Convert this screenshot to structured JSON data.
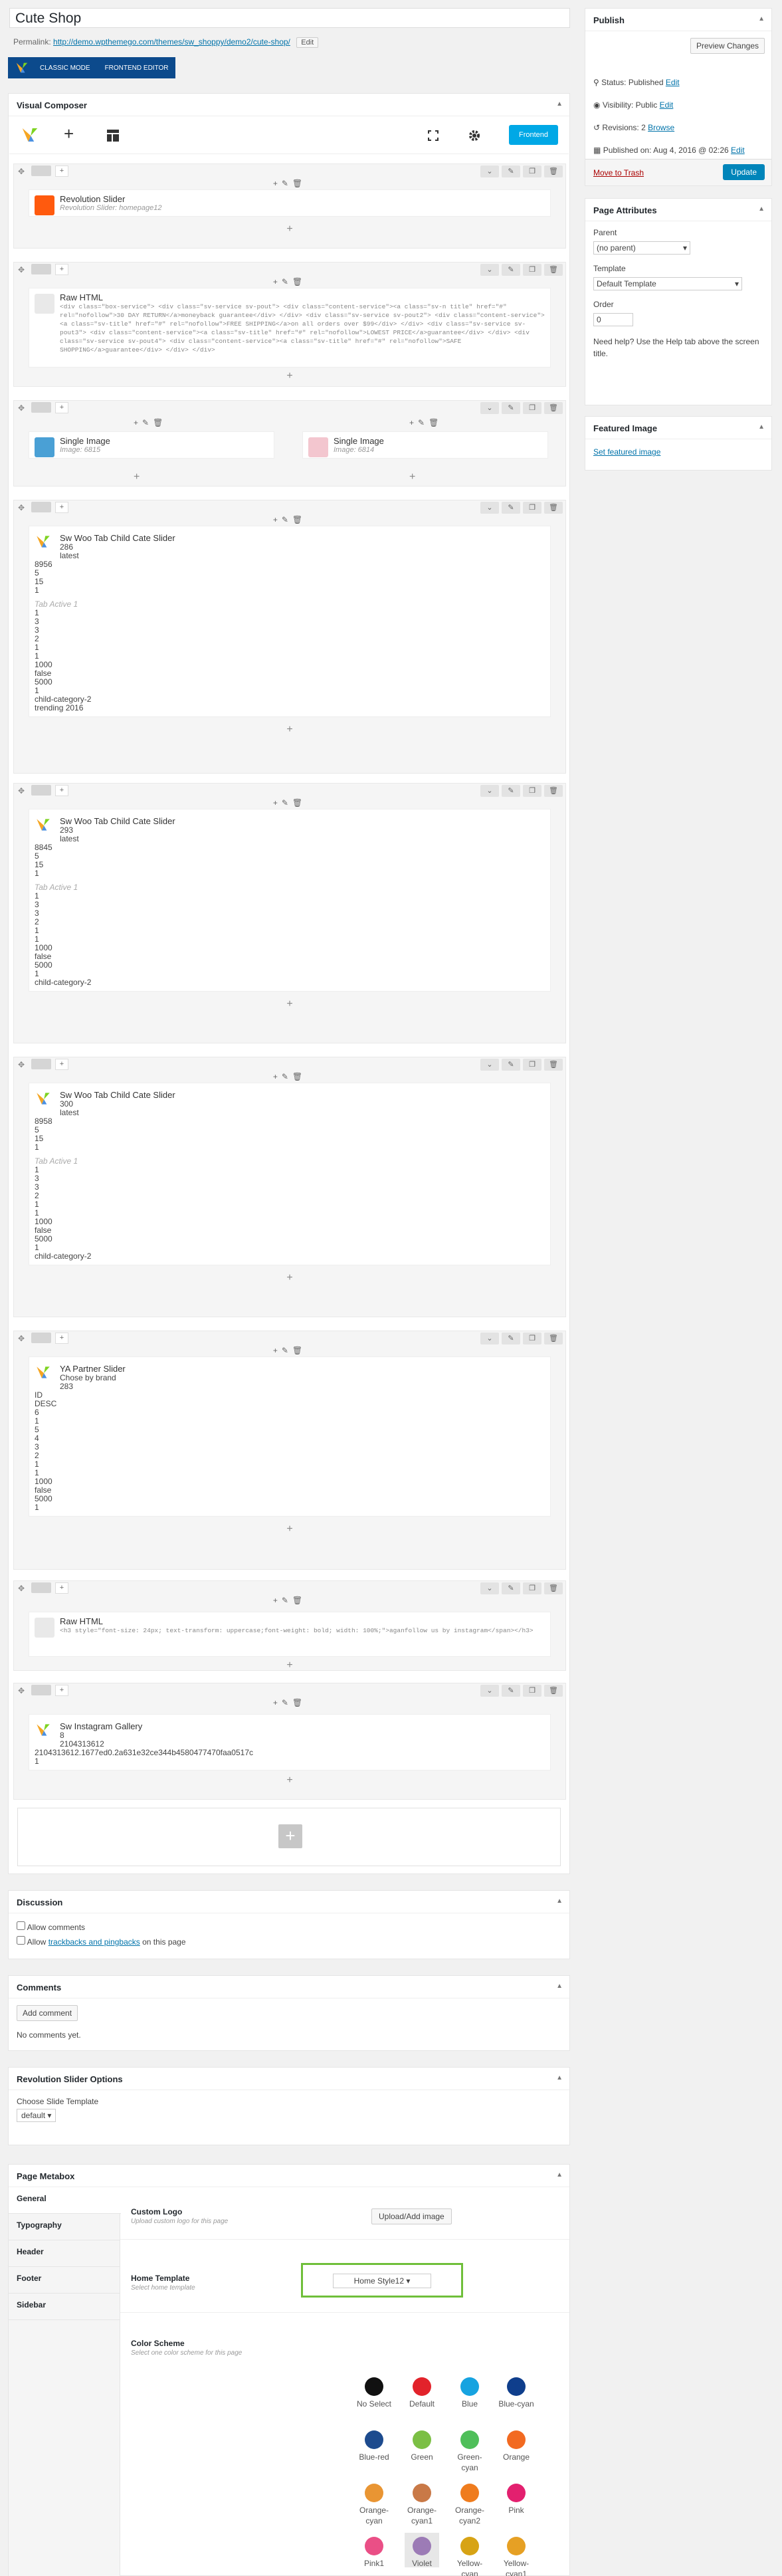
{
  "post_title": "Cute Shop",
  "permalink": {
    "label": "Permalink:",
    "url": "http://demo.wpthemego.com/themes/sw_shoppy/demo2/cute-shop/",
    "edit": "Edit"
  },
  "mode": {
    "classic": "CLASSIC MODE",
    "frontend": "FRONTEND EDITOR"
  },
  "vc": {
    "title": "Visual Composer",
    "frontend_btn": "Frontend"
  },
  "els": {
    "rev": {
      "title": "Revolution Slider",
      "sub": "Revolution Slider: homepage12"
    },
    "raw1": {
      "title": "Raw HTML",
      "code": "<div class=\"box-service\"> <div class=\"sv-service sv-pout\"> <div class=\"content-service\"><a class=\"sv-n title\" href=\"#\" rel=\"nofollow\">30 DAY RETURN</a>moneyback guarantee</div> </div> <div class=\"sv-service sv-pout2\"> <div class=\"content-service\"><a class=\"sv-title\" href=\"#\" rel=\"nofollow\">FREE SHIPPING</a>on all orders over $99</div> </div> <div class=\"sv-service sv-pout3\"> <div class=\"content-service\"><a class=\"sv-title\" href=\"#\" rel=\"nofollow\">LOWEST PRICE</a>guarantee</div> </div> <div class=\"sv-service sv-pout4\"> <div class=\"content-service\"><a class=\"sv-title\" href=\"#\" rel=\"nofollow\">SAFE SHOPPING</a>guarantee</div> </div> </div>"
    },
    "img1": {
      "title": "Single Image",
      "sub": "Image: 6815"
    },
    "img2": {
      "title": "Single Image",
      "sub": "Image: 6814"
    },
    "tab1": {
      "title": "Sw Woo Tab Child Cate Slider",
      "lines": [
        "286",
        "latest",
        "8956",
        "5",
        "15",
        "1",
        "Tab Active 1",
        "1",
        "3",
        "3",
        "2",
        "1",
        "1",
        "1000",
        "false",
        "5000",
        "1",
        "child-category-2",
        "trending 2016"
      ]
    },
    "tab2": {
      "title": "Sw Woo Tab Child Cate Slider",
      "lines": [
        "293",
        "latest",
        "8845",
        "5",
        "15",
        "1",
        "Tab Active 1",
        "1",
        "3",
        "3",
        "2",
        "1",
        "1",
        "1000",
        "false",
        "5000",
        "1",
        "child-category-2"
      ]
    },
    "tab3": {
      "title": "Sw Woo Tab Child Cate Slider",
      "lines": [
        "300",
        "latest",
        "8958",
        "5",
        "15",
        "1",
        "Tab Active 1",
        "1",
        "3",
        "3",
        "2",
        "1",
        "1",
        "1000",
        "false",
        "5000",
        "1",
        "child-category-2"
      ]
    },
    "partner": {
      "title": "YA Partner Slider",
      "lines": [
        "Chose by brand",
        "283",
        "ID",
        "DESC",
        "6",
        "1",
        "5",
        "4",
        "3",
        "2",
        "1",
        "1",
        "1000",
        "false",
        "5000",
        "1"
      ]
    },
    "raw2": {
      "title": "Raw HTML",
      "code": "<h3 style=\"font-size: 24px; text-transform: uppercase;font-weight: bold; width: 100%;\">aganfollow us by instagram</span></h3>"
    },
    "insta": {
      "title": "Sw Instagram Gallery",
      "lines": [
        "8",
        "2104313612",
        "2104313612.1677ed0.2a631e32ce344b4580477470faa0517c",
        "1"
      ]
    }
  },
  "discussion": {
    "title": "Discussion",
    "allow_comments": "Allow comments",
    "allow_prefix": "Allow",
    "trackbacks": "trackbacks and pingbacks",
    "allow_suffix": "on this page"
  },
  "comments": {
    "title": "Comments",
    "add": "Add comment",
    "none": "No comments yet."
  },
  "revslider": {
    "title": "Revolution Slider Options",
    "label": "Choose Slide Template",
    "value": "default"
  },
  "metabox": {
    "title": "Page Metabox",
    "tabs": [
      "General",
      "Typography",
      "Header",
      "Footer",
      "Sidebar"
    ],
    "logo_label": "Custom Logo",
    "logo_desc": "Upload custom logo for this page",
    "upload": "Upload/Add image",
    "home_label": "Home Template",
    "home_desc": "Select home template",
    "home_value": "Home Style12",
    "color_label": "Color Scheme",
    "color_desc": "Select one color scheme for this page",
    "swatches": [
      {
        "name": "No Select",
        "color": "#111111"
      },
      {
        "name": "Default",
        "color": "#e2232b"
      },
      {
        "name": "Blue",
        "color": "#17a3e0"
      },
      {
        "name": "Blue-cyan",
        "color": "#0f3e8c"
      },
      {
        "name": "Blue-red",
        "color": "#1d4b8e"
      },
      {
        "name": "Green",
        "color": "#7bbf44"
      },
      {
        "name": "Green-cyan",
        "color": "#4fbf5a"
      },
      {
        "name": "Orange",
        "color": "#f26a21"
      },
      {
        "name": "Orange-cyan",
        "color": "#e99533"
      },
      {
        "name": "Orange-cyan1",
        "color": "#c97947"
      },
      {
        "name": "Orange-cyan2",
        "color": "#ef7c1e"
      },
      {
        "name": "Pink",
        "color": "#e3206f"
      },
      {
        "name": "Pink1",
        "color": "#ea4f86"
      },
      {
        "name": "Violet",
        "color": "#9c7bb6"
      },
      {
        "name": "Yellow-cyan",
        "color": "#d7a315"
      },
      {
        "name": "Yellow-cyan1",
        "color": "#e6a024"
      },
      {
        "name": "",
        "color": "#9e1a20"
      }
    ]
  },
  "publish": {
    "title": "Publish",
    "preview": "Preview Changes",
    "status": "Status: Published",
    "visibility": "Visibility: Public",
    "revisions": "Revisions: 2",
    "browse": "Browse",
    "published": "Published on: Aug 4, 2016 @ 02:26",
    "edit": "Edit",
    "trash": "Move to Trash",
    "update": "Update"
  },
  "attrs": {
    "title": "Page Attributes",
    "parent": "Parent",
    "parent_val": "(no parent)",
    "template": "Template",
    "template_val": "Default Template",
    "order": "Order",
    "order_val": "0",
    "help": "Need help? Use the Help tab above the screen title."
  },
  "featured": {
    "title": "Featured Image",
    "link": "Set featured image"
  }
}
